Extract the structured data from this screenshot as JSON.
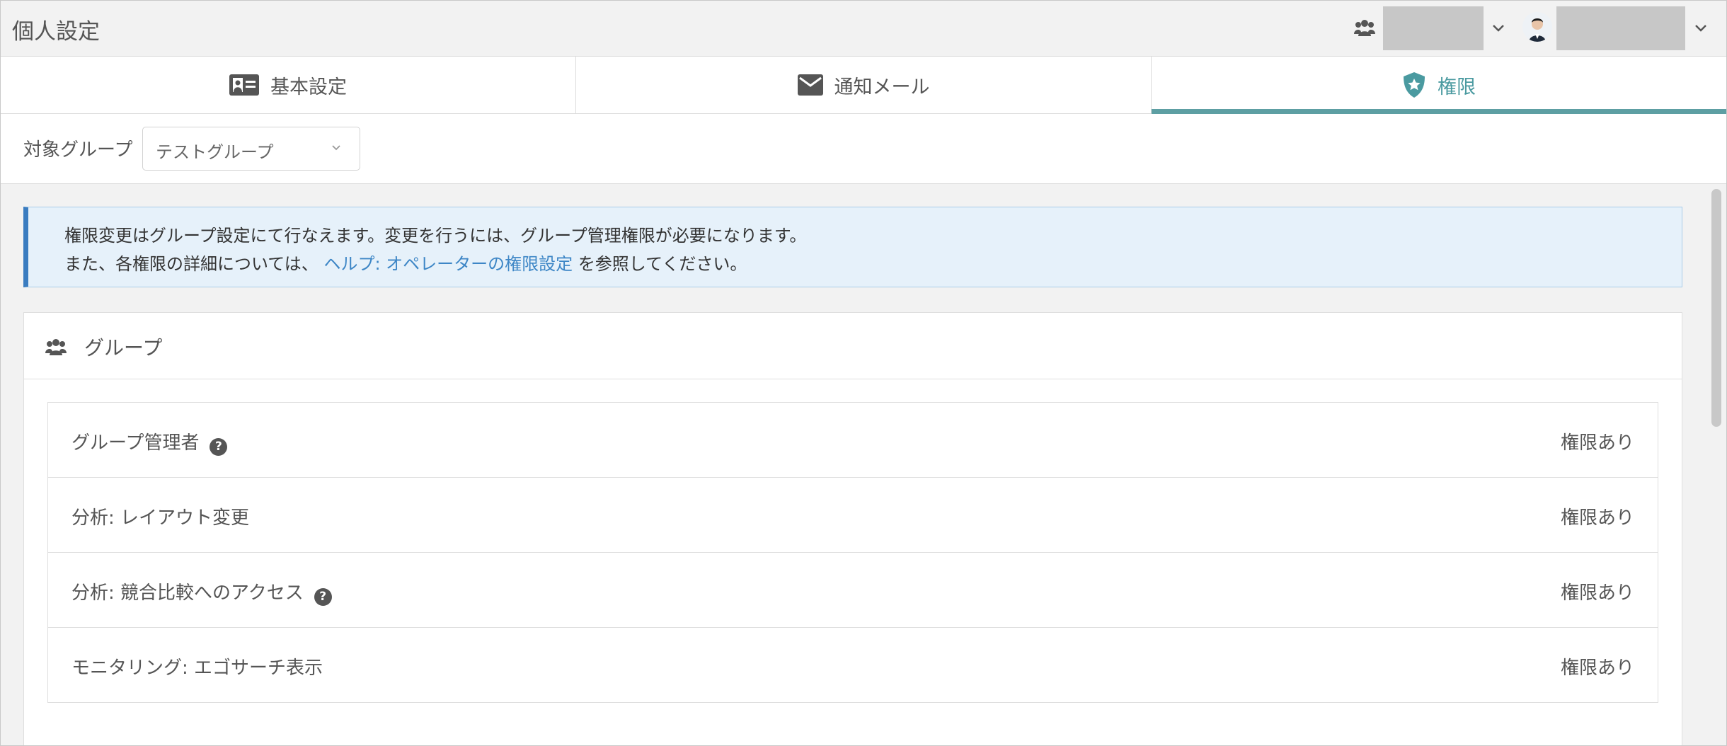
{
  "header": {
    "title": "個人設定",
    "group_icon": "group-icon",
    "user_menu_icon": "chevron-down-icon"
  },
  "tabs": [
    {
      "label": "基本設定",
      "icon": "id-card-icon",
      "active": false
    },
    {
      "label": "通知メール",
      "icon": "mail-icon",
      "active": false
    },
    {
      "label": "権限",
      "icon": "shield-star-icon",
      "active": true
    }
  ],
  "filter": {
    "label": "対象グループ",
    "selected": "テストグループ"
  },
  "notice": {
    "line1": "権限変更はグループ設定にて行なえます。変更を行うには、グループ管理権限が必要になります。",
    "line2_prefix": "また、各権限の詳細については、",
    "link_text": "ヘルプ: オペレーターの権限設定",
    "line2_suffix": "を参照してください。"
  },
  "panel": {
    "title": "グループ",
    "rows": [
      {
        "name": "グループ管理者",
        "status": "権限あり",
        "has_help": true
      },
      {
        "name": "分析: レイアウト変更",
        "status": "権限あり",
        "has_help": false
      },
      {
        "name": "分析: 競合比較へのアクセス",
        "status": "権限あり",
        "has_help": true
      },
      {
        "name": "モニタリング: エゴサーチ表示",
        "status": "権限あり",
        "has_help": false
      }
    ]
  },
  "colors": {
    "accent": "#5d9fa3",
    "active_tab_text": "#4a9aa0",
    "notice_border": "#3a7cc0",
    "notice_bg": "#e6f1fa",
    "link": "#3d86c6"
  }
}
